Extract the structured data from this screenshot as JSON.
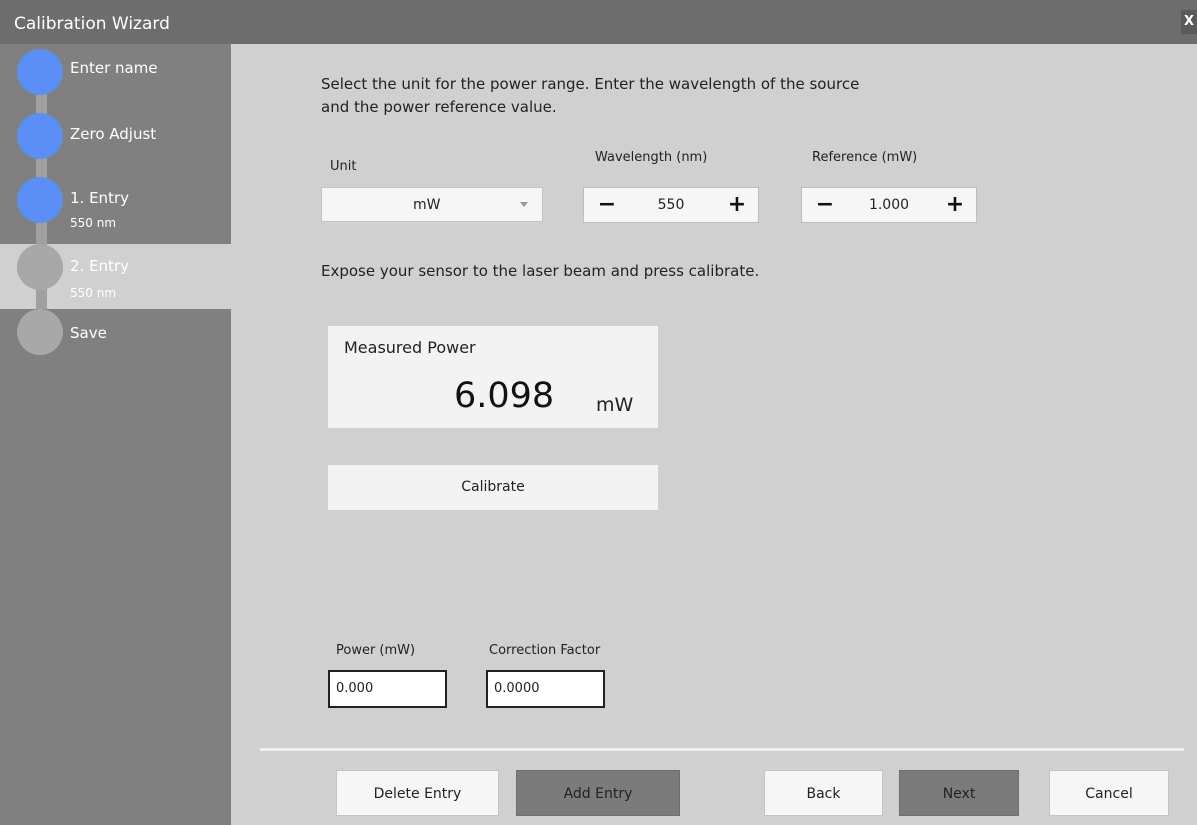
{
  "window": {
    "title": "Calibration Wizard",
    "close_label": "X"
  },
  "sidebar": {
    "steps": [
      {
        "label": "Enter name",
        "sub": "",
        "state": "done"
      },
      {
        "label": "Zero Adjust",
        "sub": "",
        "state": "done"
      },
      {
        "label": "1. Entry",
        "sub": "550 nm",
        "state": "done"
      },
      {
        "label": "2. Entry",
        "sub": "550 nm",
        "state": "current"
      },
      {
        "label": "Save",
        "sub": "",
        "state": "pending"
      }
    ]
  },
  "main": {
    "instruction_1": "Select the unit for the power range. Enter the wavelength of the source",
    "instruction_2": "and the power reference value.",
    "unit": {
      "label": "Unit",
      "value": "mW"
    },
    "wavelength": {
      "label": "Wavelength (nm)",
      "value": "550",
      "minus": "−",
      "plus": "+"
    },
    "reference": {
      "label": "Reference (mW)",
      "value": "1.000",
      "minus": "−",
      "plus": "+"
    },
    "expose_instruction": "Expose your sensor to the laser beam and press calibrate.",
    "measured_power": {
      "label": "Measured Power",
      "value": "6.098",
      "unit": "mW"
    },
    "calibrate_label": "Calibrate",
    "power_field": {
      "label": "Power (mW)",
      "value": "0.000"
    },
    "correction_field": {
      "label": "Correction Factor",
      "value": "0.0000"
    }
  },
  "footer": {
    "delete_entry": "Delete Entry",
    "add_entry": "Add Entry",
    "back": "Back",
    "next": "Next",
    "cancel": "Cancel"
  },
  "colors": {
    "step_done": "#5b8ff4",
    "step_pending": "#a8a8a8",
    "sidebar_bg": "#808080",
    "content_bg": "#d0d0d0"
  }
}
